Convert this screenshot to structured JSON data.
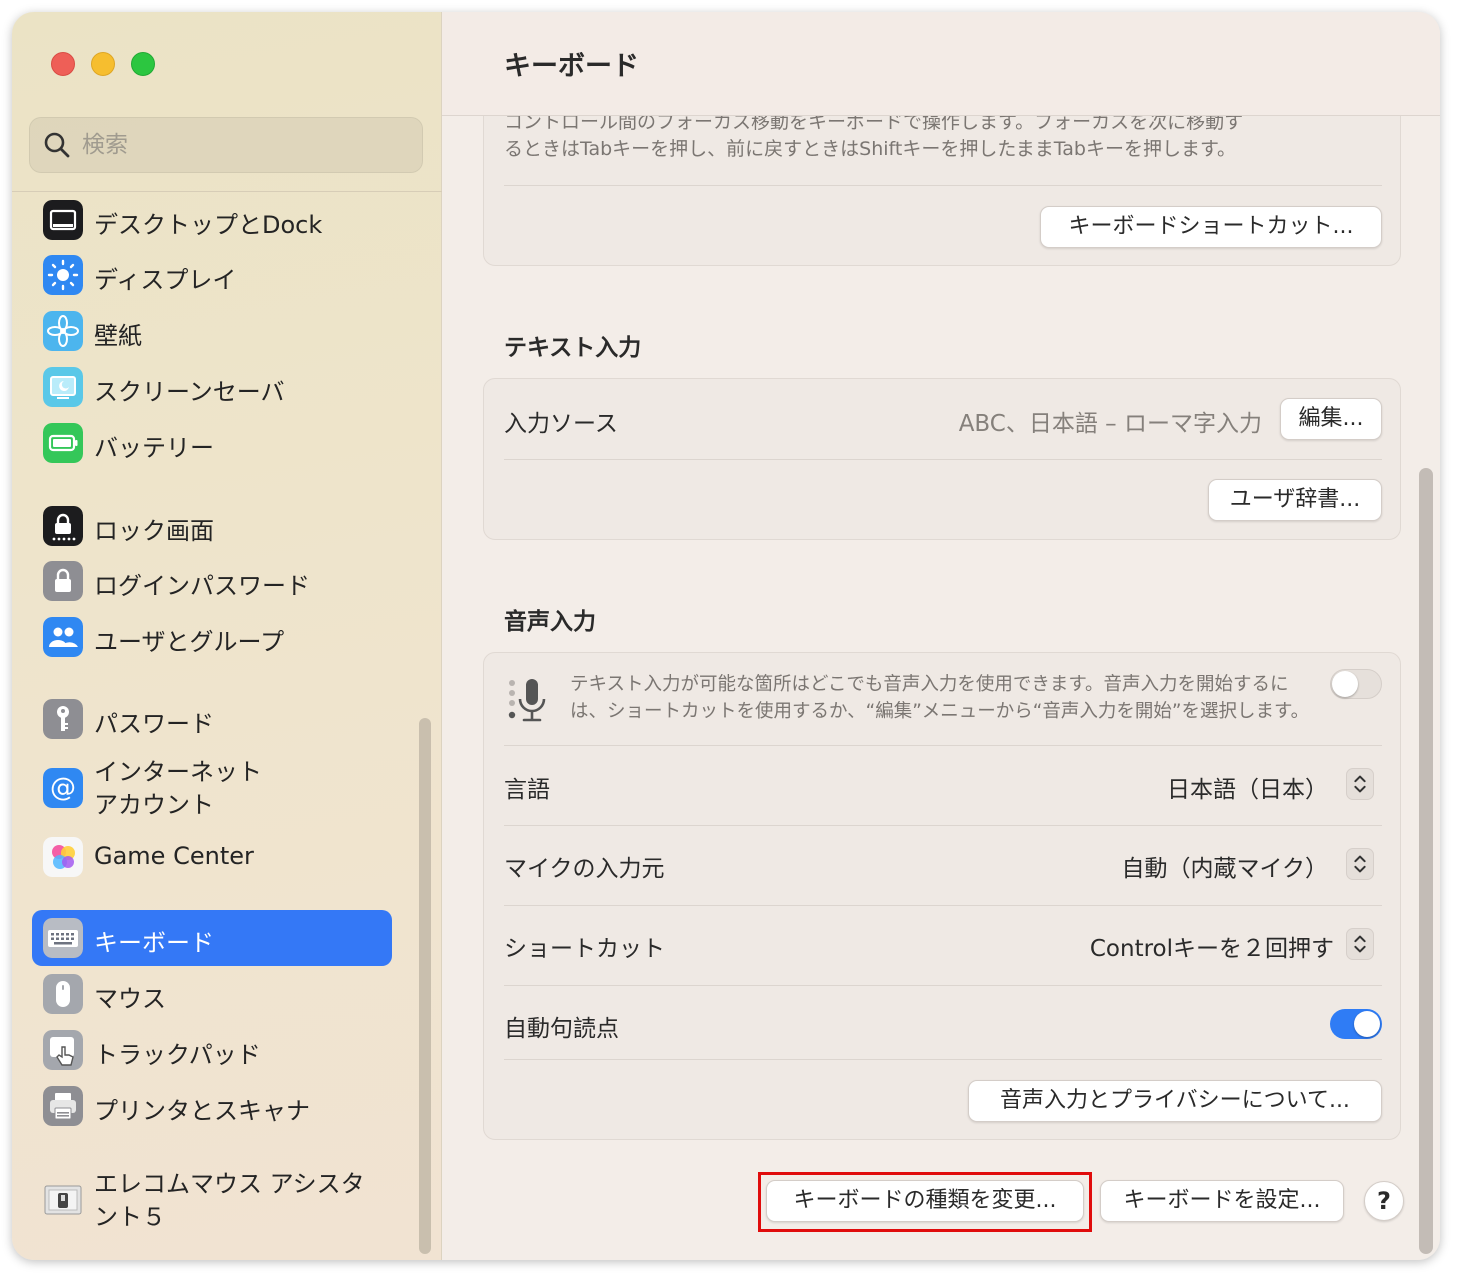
{
  "sidebar": {
    "search_placeholder": "検索",
    "items": [
      {
        "label": "デスクトップとDock",
        "icon": "desktop-dock-icon"
      },
      {
        "label": "ディスプレイ",
        "icon": "display-icon"
      },
      {
        "label": "壁紙",
        "icon": "wallpaper-icon"
      },
      {
        "label": "スクリーンセーバ",
        "icon": "screensaver-icon"
      },
      {
        "label": "バッテリー",
        "icon": "battery-icon"
      },
      {
        "label": "ロック画面",
        "icon": "lock-screen-icon"
      },
      {
        "label": "ログインパスワード",
        "icon": "login-password-icon"
      },
      {
        "label": "ユーザとグループ",
        "icon": "users-groups-icon"
      },
      {
        "label": "パスワード",
        "icon": "key-icon"
      },
      {
        "label": "インターネット\nアカウント",
        "icon": "at-sign-icon"
      },
      {
        "label": "Game Center",
        "icon": "game-center-icon"
      },
      {
        "label": "キーボード",
        "icon": "keyboard-icon",
        "selected": true
      },
      {
        "label": "マウス",
        "icon": "mouse-icon"
      },
      {
        "label": "トラックパッド",
        "icon": "trackpad-icon"
      },
      {
        "label": "プリンタとスキャナ",
        "icon": "printer-icon"
      },
      {
        "label": "エレコムマウス アシスタ\nント５",
        "icon": "elecom-mouse-icon"
      }
    ]
  },
  "main": {
    "title": "キーボード",
    "keyboard_nav": {
      "description": "コントロール間のフォーカス移動をキーボードで操作します。フォーカスを次に移動するときはTabキーを押し、前に戻すときはShiftキーを押したままTabキーを押します。",
      "desc_line1": "コントロール間のフォーカス移動をキーボードで操作します。フォーカスを次に移動す",
      "desc_line2": "るときはTabキーを押し、前に戻すときはShiftキーを押したままTabキーを押します。",
      "shortcuts_button": "キーボードショートカット..."
    },
    "text_input": {
      "section_title": "テキスト入力",
      "input_source_label": "入力ソース",
      "input_source_value": "ABC、日本語 – ローマ字入力",
      "edit_button": "編集...",
      "user_dict_button": "ユーザ辞書..."
    },
    "dictation": {
      "section_title": "音声入力",
      "description_line1": "テキスト入力が可能な箇所はどこでも音声入力を使用できます。音声入力を開始するに",
      "description_line2": "は、ショートカットを使用するか、“編集”メニューから“音声入力を開始”を選択します。",
      "enabled": false,
      "language_label": "言語",
      "language_value": "日本語（日本）",
      "mic_label": "マイクの入力元",
      "mic_value": "自動（内蔵マイク）",
      "shortcut_label": "ショートカット",
      "shortcut_value": "Controlキーを２回押す",
      "auto_punct_label": "自動句読点",
      "auto_punct_enabled": true,
      "privacy_button": "音声入力とプライバシーについて..."
    },
    "footer": {
      "change_type_button": "キーボードの種類を変更...",
      "setup_button": "キーボードを設定...",
      "help_button": "?"
    }
  },
  "colors": {
    "accent": "#3478f6",
    "highlight_box": "#e00c0c"
  }
}
